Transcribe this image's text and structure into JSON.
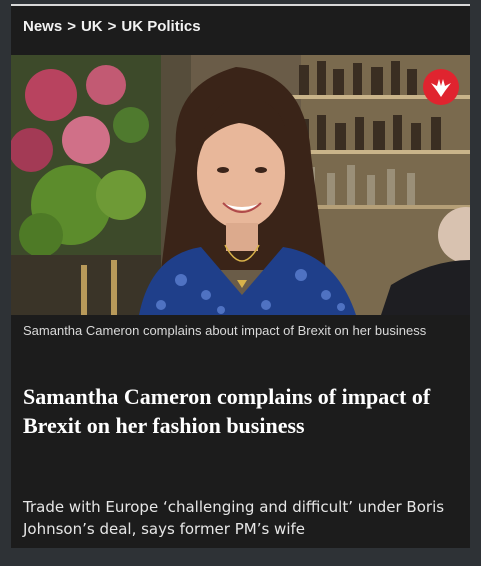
{
  "breadcrumb": {
    "items": [
      "News",
      "UK",
      "UK Politics"
    ],
    "separator": ">"
  },
  "hero": {
    "logo_icon": "eagle-logo-icon",
    "logo_color": "#e0242f"
  },
  "article": {
    "caption": "Samantha Cameron complains about impact of Brexit on her business",
    "headline": "Samantha Cameron complains of impact of Brexit on her fashion business",
    "standfirst": "Trade with Europe ‘challenging and difficult’ under Boris Johnson’s deal, says former PM’s wife"
  }
}
